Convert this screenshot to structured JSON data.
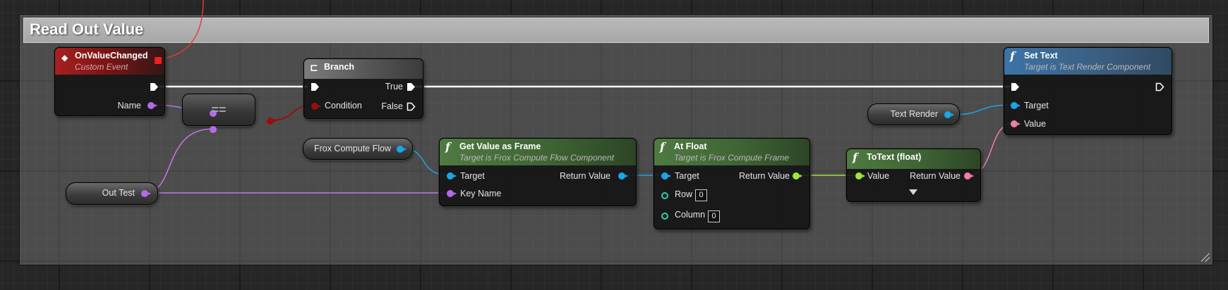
{
  "comment": {
    "title": "Read Out Value"
  },
  "nodes": {
    "on_value_changed": {
      "title": "OnValueChanged",
      "subtitle": "Custom Event",
      "pin_name": "Name"
    },
    "branch": {
      "title": "Branch",
      "condition": "Condition",
      "true_label": "True",
      "false_label": "False"
    },
    "compare": {
      "operator": "=="
    },
    "set_text": {
      "title": "Set Text",
      "subtitle": "Target is Text Render Component",
      "target": "Target",
      "value": "Value"
    },
    "text_render": {
      "label": "Text Render"
    },
    "frox_compute_flow": {
      "label": "Frox Compute Flow"
    },
    "out_test": {
      "label": "Out Test"
    },
    "get_value_as_frame": {
      "title": "Get Value as Frame",
      "subtitle": "Target is Frox Compute Flow Component",
      "target": "Target",
      "key_name": "Key Name",
      "return_value": "Return Value"
    },
    "at_float": {
      "title": "At Float",
      "subtitle": "Target is Frox Compute Frame",
      "target": "Target",
      "row": "Row",
      "row_value": "0",
      "column": "Column",
      "column_value": "0",
      "return_value": "Return Value"
    },
    "to_text": {
      "title": "ToText (float)",
      "value": "Value",
      "return_value": "Return Value"
    }
  },
  "icons": {
    "function": "f",
    "event": "◆",
    "branch": "⊏"
  },
  "colors": {
    "exec_wire": "#ffffff",
    "name_wire": "#c277ea",
    "object_wire": "#1aa6e8",
    "float_wire": "#9be83a",
    "text_wire": "#ee7eac",
    "bool_wire": "#9a0e0e",
    "delegate_wire": "#e83a3a"
  }
}
